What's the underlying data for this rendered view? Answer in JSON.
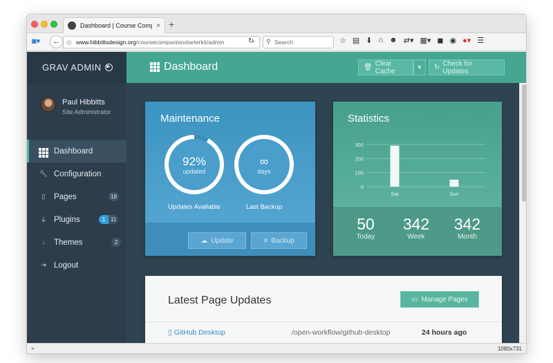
{
  "browser": {
    "tab_title": "Dashboard | Course Comp...",
    "tab_close": "×",
    "new_tab": "+",
    "url_domain": "www.hibbittsdesign.org",
    "url_path": "/coursecompanionstarterkit/admin",
    "search_placeholder": "Search"
  },
  "sidebar": {
    "brand": "GRAV ADMIN",
    "user_name": "Paul Hibbitts",
    "user_role": "Site Administrator",
    "items": [
      {
        "label": "Dashboard",
        "icon": "grid-icon"
      },
      {
        "label": "Configuration",
        "icon": "wrench-icon"
      },
      {
        "label": "Pages",
        "icon": "file-icon",
        "badge": "18"
      },
      {
        "label": "Plugins",
        "icon": "plug-icon",
        "badge_update": "1",
        "badge": "11"
      },
      {
        "label": "Themes",
        "icon": "drop-icon",
        "badge": "2"
      },
      {
        "label": "Logout",
        "icon": "sign-out-icon"
      }
    ]
  },
  "header": {
    "title": "Dashboard",
    "clear_cache": "Clear Cache",
    "check_updates": "Check for Updates"
  },
  "maintenance": {
    "title": "Maintenance",
    "updated_value": "92%",
    "updated_fraction": 0.92,
    "updated_sub": "updated",
    "updated_label": "Updates Available",
    "backup_value": "∞",
    "backup_sub": "days",
    "backup_label": "Last Backup",
    "update_button": "Update",
    "backup_button": "Backup"
  },
  "statistics": {
    "title": "Statistics",
    "today_value": "50",
    "today_label": "Today",
    "week_value": "342",
    "week_label": "Week",
    "month_value": "342",
    "month_label": "Month"
  },
  "chart_data": {
    "type": "bar",
    "categories": [
      "Sat",
      "Sun"
    ],
    "values": [
      292,
      50
    ],
    "ylim": [
      0,
      300
    ],
    "yticks": [
      0,
      100,
      200,
      300
    ],
    "grid": true,
    "colors": {
      "bar": "#ffffff",
      "grid": "#7cc3b3"
    }
  },
  "updates": {
    "title": "Latest Page Updates",
    "manage_button": "Manage Pages",
    "rows": [
      {
        "title": "GitHub Desktop",
        "path": "/open-workflow/github-desktop",
        "when": "24 hours ago"
      }
    ]
  },
  "statusbar": {
    "close": "×",
    "resolution": "1080x731"
  },
  "colors": {
    "accent": "#45a692",
    "sidebar": "#2d3d4b",
    "maintenance": "#4a9ecb",
    "link": "#2e8ec5"
  }
}
